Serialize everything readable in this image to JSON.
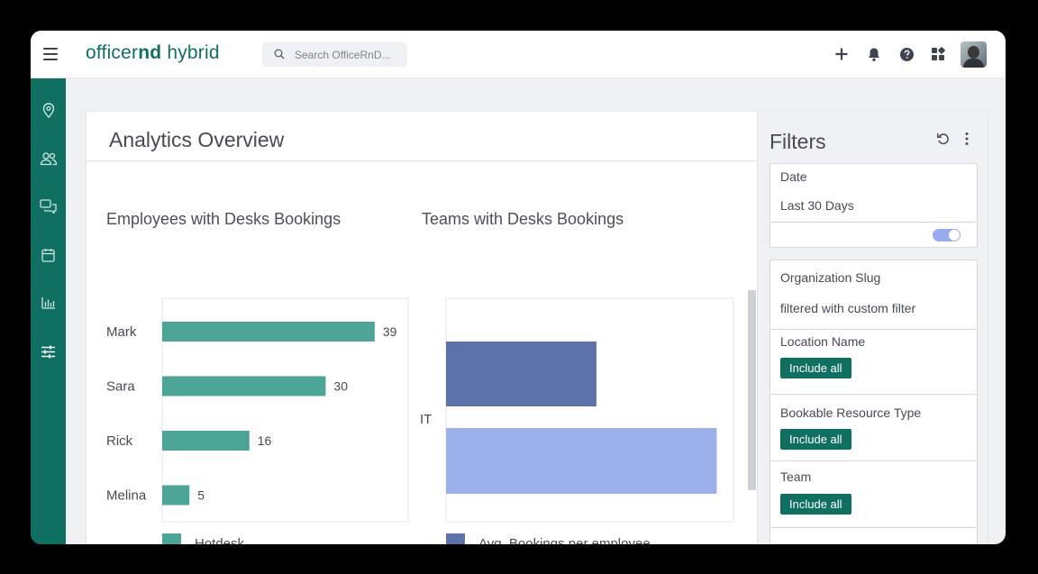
{
  "app": {
    "logo_light": "officer",
    "logo_bold": "nd",
    "logo_tail": " hybrid"
  },
  "search": {
    "placeholder": "Search OfficeRnD..."
  },
  "header": {
    "icons": [
      "plus-icon",
      "bell-icon",
      "help-icon",
      "apps-grid-icon"
    ]
  },
  "sidebar": {
    "icons": [
      "location-pin-icon",
      "people-icon",
      "chat-icon",
      "calendar-icon",
      "bar-chart-icon",
      "sliders-icon"
    ]
  },
  "page": {
    "title": "Analytics Overview"
  },
  "charts": {
    "employees_title": "Employees with Desks Bookings",
    "teams_title": "Teams with Desks Bookings"
  },
  "chart_data": [
    {
      "type": "bar",
      "orientation": "horizontal",
      "title": "Employees with Desks Bookings",
      "categories": [
        "Mark",
        "Sara",
        "Rick",
        "Melina"
      ],
      "series": [
        {
          "name": "Hotdesk",
          "values": [
            39,
            30,
            16,
            5
          ],
          "color": "#4ca597"
        }
      ],
      "data_labels": true,
      "xlim": [
        0,
        45
      ],
      "grid": false,
      "legend": "bottom-left"
    },
    {
      "type": "bar",
      "orientation": "horizontal",
      "title": "Teams with Desks Bookings",
      "categories": [
        "IT"
      ],
      "series": [
        {
          "name": "Avg. Bookings per employee",
          "values": [
            22.5
          ],
          "color": "#5d72aa"
        },
        {
          "values": [
            40.5
          ],
          "color": "#9cb0ec"
        }
      ],
      "xlim": [
        0,
        43
      ],
      "grid": false,
      "legend": "bottom-left"
    }
  ],
  "filters": {
    "title": "Filters",
    "date_label": "Date",
    "date_value": "Last 30 Days",
    "org_label": "Organization Slug",
    "org_value": "filtered with custom filter",
    "location_label": "Location Name",
    "resource_label": "Bookable Resource Type",
    "team_label": "Team",
    "include_all": "Include all"
  },
  "colors": {
    "brand": "#0f6f61",
    "bar_hotdesk": "#4ca597",
    "bar_team_dark": "#5d72aa",
    "bar_team_light": "#9cb0ec"
  }
}
